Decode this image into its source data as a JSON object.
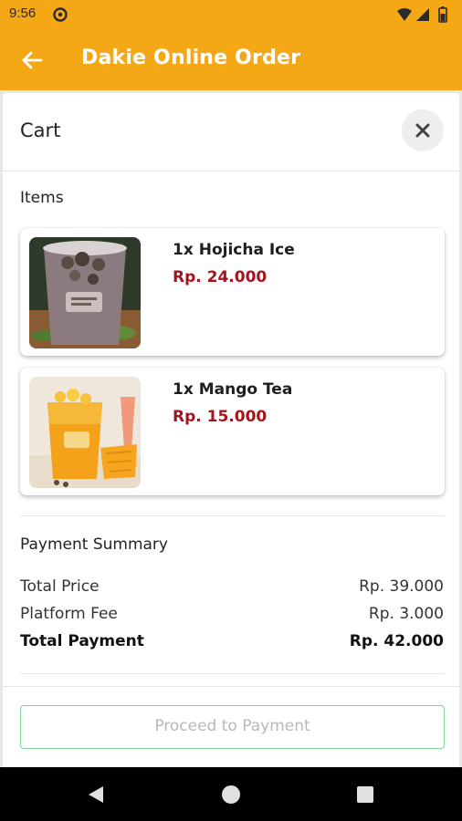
{
  "status_bar": {
    "time": "9:56",
    "icons": [
      "app-notification-icon",
      "wifi-icon",
      "signal-icon",
      "battery-icon"
    ]
  },
  "app_bar": {
    "title": "Dakie Online Order",
    "back_icon": "arrow-left-icon",
    "background_color": "#f5a815"
  },
  "cart": {
    "title": "Cart",
    "close_icon": "close-icon",
    "items_label": "Items",
    "items": [
      {
        "name": "1x Hojicha Ice",
        "price": "Rp. 24.000",
        "image": "hojicha-ice-drink-photo"
      },
      {
        "name": "1x Mango Tea",
        "price": "Rp. 15.000",
        "image": "mango-tea-drink-photo"
      }
    ],
    "price_color": "#a3141d"
  },
  "payment_summary": {
    "title": "Payment Summary",
    "rows": [
      {
        "label": "Total Price",
        "value": "Rp. 39.000"
      },
      {
        "label": "Platform Fee",
        "value": "Rp. 3.000"
      },
      {
        "label": "Total Payment",
        "value": "Rp. 42.000"
      }
    ]
  },
  "actions": {
    "proceed_label": "Proceed to Payment",
    "proceed_enabled": false,
    "border_color": "#7fd49a"
  },
  "nav_bar": {
    "icons": [
      "nav-back-icon",
      "nav-home-icon",
      "nav-recents-icon"
    ]
  }
}
